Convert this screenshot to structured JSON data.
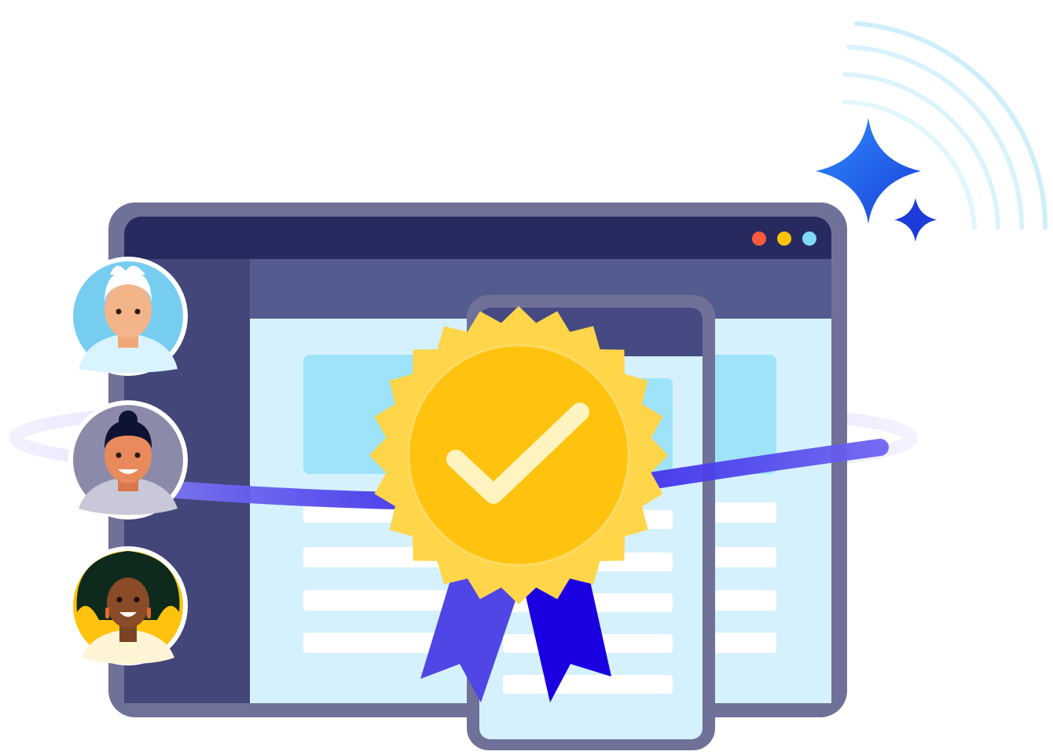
{
  "illustration": {
    "subject": "verified-badge-over-browser-window",
    "colors": {
      "window_frame": "#6f7199",
      "window_titlebar": "#262a5e",
      "window_sidebar": "#424679",
      "window_header": "#545b8e",
      "content_bg": "#d5f1fd",
      "content_block": "#9fe3fb",
      "content_line": "#ffffff",
      "phone_frame": "#6f7199",
      "phone_header": "#454a82",
      "badge_gold": "#ffc20e",
      "badge_gold_light": "#ffd54a",
      "ribbon_left": "#4f46e5",
      "ribbon_right": "#1a00e0",
      "orbit": "#7c6cf2",
      "sparkle": "#1e5fe8",
      "signal": "#c7ecfb",
      "dot_red": "#ff5a3c",
      "dot_yellow": "#ffc20e",
      "dot_cyan": "#7fd9f5"
    },
    "icons": [
      "avatar-elder-icon",
      "avatar-man-icon",
      "avatar-woman-icon",
      "check-badge-icon",
      "sparkle-icon",
      "signal-waves-icon"
    ]
  }
}
